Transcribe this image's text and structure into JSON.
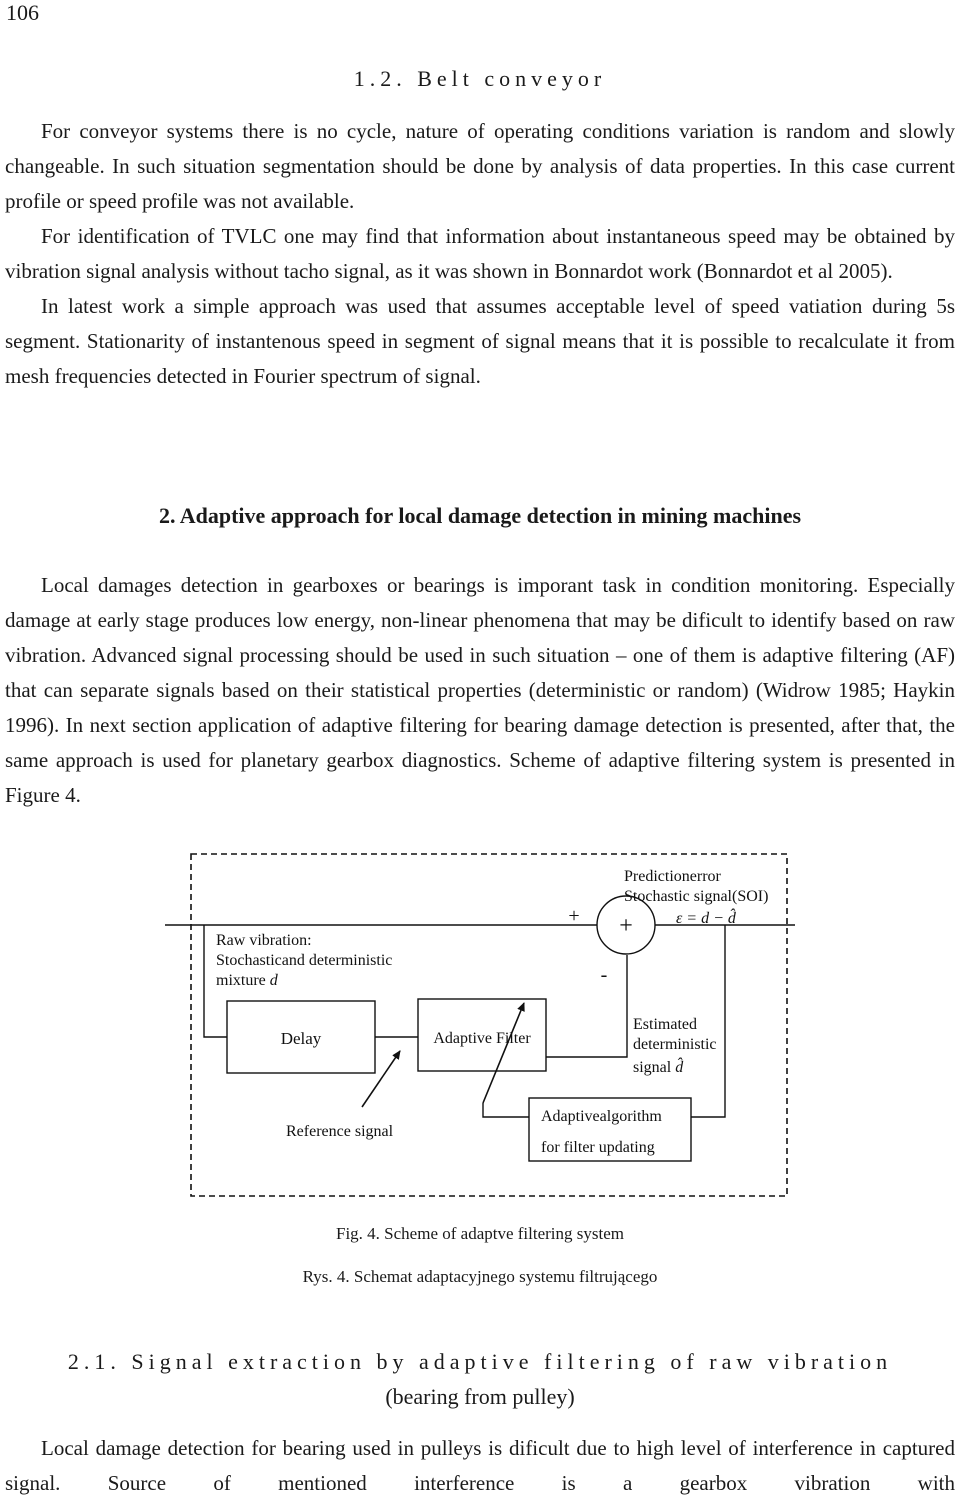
{
  "page_number": "106",
  "section_1_2": {
    "title": "1.2. Belt conveyor",
    "paragraphs": [
      "For conveyor systems there is no cycle, nature of operating conditions variation is random and slowly changeable. In such situation segmentation should be done by analysis of data properties. In this case current profile or speed profile was not available.",
      "For identification of TVLC one may find that information about instantaneous speed may be obtained by vibration signal analysis without tacho signal, as it was shown in Bonnardot work (Bonnardot et al 2005).",
      "In latest work a simple approach was used that assumes acceptable level of speed vatiation during 5s segment. Stationarity of instantenous speed in segment of signal means that it is possible to recalculate it from mesh frequencies detected in Fourier spectrum of signal."
    ]
  },
  "section_2": {
    "title": "2. Adaptive approach for local damage detection in mining machines",
    "paragraph": "Local damages detection in gearboxes or bearings is imporant task in condition monitoring. Especially damage at early stage produces low energy, non-linear phenomena that may be dificult to identify based on raw vibration. Advanced signal processing should be used in such situation – one of them is adaptive filtering (AF) that can separate signals based on their statistical properties (deterministic or random) (Widrow 1985; Haykin 1996). In next section application of adaptive filtering for bearing damage detection is presented, after that, the same approach is used for planetary gearbox diagnostics. Scheme of adaptive filtering system is presented in Figure 4."
  },
  "figure": {
    "raw_vibration_label": [
      "Raw vibration:",
      "Stochasticand deterministic",
      "mixture "
    ],
    "raw_vibration_var": "d",
    "delay_label": "Delay",
    "adaptive_filter_label": "Adaptive Filter",
    "reference_signal_label": "Reference signal",
    "algorithm_label": [
      "Adaptivealgorithm",
      "for filter updating"
    ],
    "summer_symbol": "+",
    "plus_sign": "+",
    "minus_sign": "-",
    "prediction_error_label": [
      "Predictionerror",
      "Stochastic signal(SOI)"
    ],
    "error_equation": "ε = d − d̂",
    "estimated_label": [
      "Estimated",
      "deterministic",
      "signal "
    ],
    "estimated_var": "d̂",
    "caption_en": "Fig. 4. Scheme of adaptve filtering system",
    "caption_pl": "Rys. 4. Schemat adaptacyjnego systemu filtrującego"
  },
  "section_2_1": {
    "title": "2.1. Signal extraction by adaptive filtering of raw vibration",
    "subtitle": "(bearing from pulley)",
    "paragraph": "Local damage detection for bearing used in pulleys is dificult due to high level of interference in captured signal. Source of mentioned interference is a gearbox vibration with"
  }
}
